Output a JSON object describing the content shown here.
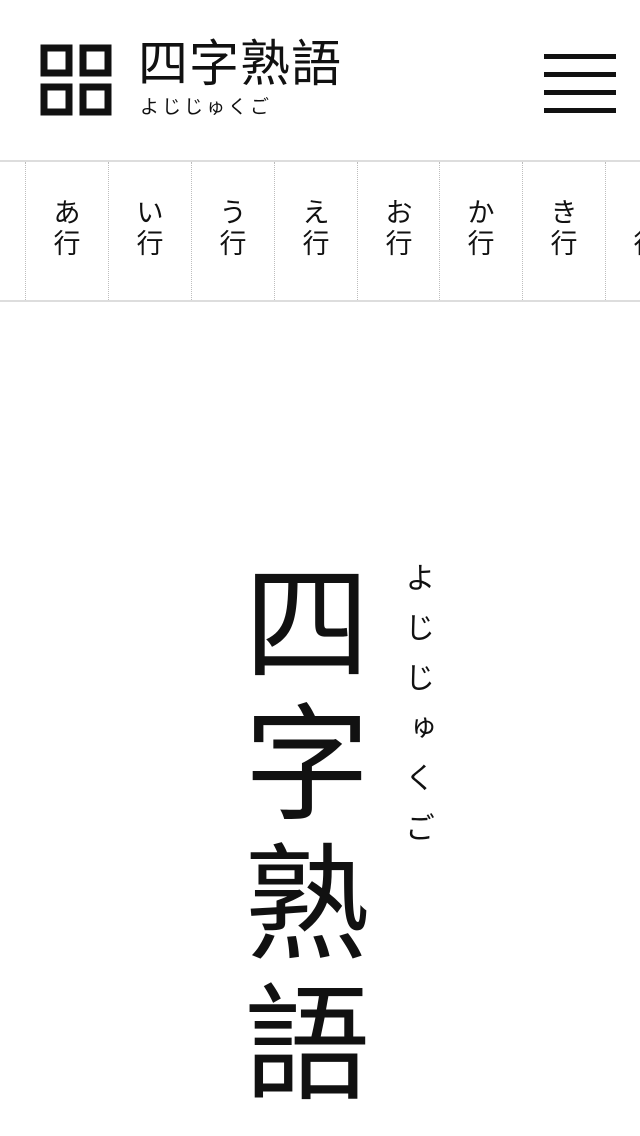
{
  "header": {
    "title": "四字熟語",
    "reading": "よじじゅくご",
    "logo_icon": "four-squares-icon",
    "menu_icon": "hamburger-menu-icon"
  },
  "tabs": [
    {
      "kana": "あ",
      "gyo": "行"
    },
    {
      "kana": "い",
      "gyo": "行"
    },
    {
      "kana": "う",
      "gyo": "行"
    },
    {
      "kana": "え",
      "gyo": "行"
    },
    {
      "kana": "お",
      "gyo": "行"
    },
    {
      "kana": "か",
      "gyo": "行"
    },
    {
      "kana": "き",
      "gyo": "行"
    },
    {
      "kana": "",
      "gyo": "行"
    }
  ],
  "hero": {
    "title": "四字熟語",
    "reading": "よじじゅくご"
  },
  "colors": {
    "text": "#111111",
    "background": "#ffffff",
    "divider": "#dddddd"
  }
}
